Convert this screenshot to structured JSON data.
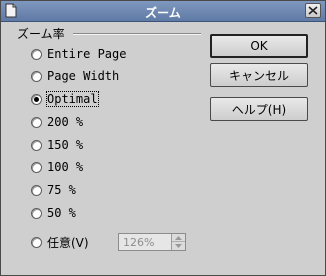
{
  "window": {
    "title": "ズーム",
    "title_icon": "document-icon",
    "close_icon": "close-icon"
  },
  "group": {
    "label": "ズーム率"
  },
  "options": [
    {
      "label": "Entire Page",
      "checked": false
    },
    {
      "label": "Page Width",
      "checked": false
    },
    {
      "label": "Optimal",
      "checked": true
    },
    {
      "label": "200 %",
      "checked": false
    },
    {
      "label": "150 %",
      "checked": false
    },
    {
      "label": "100 %",
      "checked": false
    },
    {
      "label": "75 %",
      "checked": false
    },
    {
      "label": "50 %",
      "checked": false
    },
    {
      "label": "任意(V)",
      "checked": false
    }
  ],
  "custom_zoom": {
    "value": "126%",
    "enabled": false
  },
  "buttons": {
    "ok": "OK",
    "cancel": "キャンセル",
    "help": "ヘルプ(H)"
  },
  "colors": {
    "titlebar": "#6f89b3",
    "dialog_bg": "#cfcfcf"
  }
}
